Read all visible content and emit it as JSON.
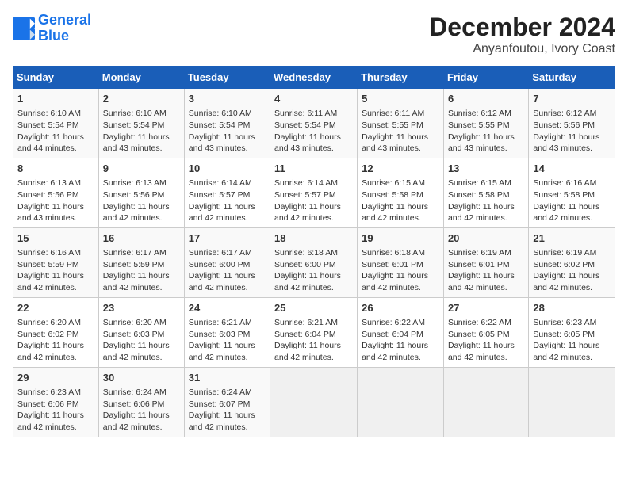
{
  "header": {
    "logo_line1": "General",
    "logo_line2": "Blue",
    "title": "December 2024",
    "subtitle": "Anyanfoutou, Ivory Coast"
  },
  "calendar": {
    "days_of_week": [
      "Sunday",
      "Monday",
      "Tuesday",
      "Wednesday",
      "Thursday",
      "Friday",
      "Saturday"
    ],
    "weeks": [
      [
        {
          "day": "1",
          "content": "Sunrise: 6:10 AM\nSunset: 5:54 PM\nDaylight: 11 hours\nand 44 minutes."
        },
        {
          "day": "2",
          "content": "Sunrise: 6:10 AM\nSunset: 5:54 PM\nDaylight: 11 hours\nand 43 minutes."
        },
        {
          "day": "3",
          "content": "Sunrise: 6:10 AM\nSunset: 5:54 PM\nDaylight: 11 hours\nand 43 minutes."
        },
        {
          "day": "4",
          "content": "Sunrise: 6:11 AM\nSunset: 5:54 PM\nDaylight: 11 hours\nand 43 minutes."
        },
        {
          "day": "5",
          "content": "Sunrise: 6:11 AM\nSunset: 5:55 PM\nDaylight: 11 hours\nand 43 minutes."
        },
        {
          "day": "6",
          "content": "Sunrise: 6:12 AM\nSunset: 5:55 PM\nDaylight: 11 hours\nand 43 minutes."
        },
        {
          "day": "7",
          "content": "Sunrise: 6:12 AM\nSunset: 5:56 PM\nDaylight: 11 hours\nand 43 minutes."
        }
      ],
      [
        {
          "day": "8",
          "content": "Sunrise: 6:13 AM\nSunset: 5:56 PM\nDaylight: 11 hours\nand 43 minutes."
        },
        {
          "day": "9",
          "content": "Sunrise: 6:13 AM\nSunset: 5:56 PM\nDaylight: 11 hours\nand 42 minutes."
        },
        {
          "day": "10",
          "content": "Sunrise: 6:14 AM\nSunset: 5:57 PM\nDaylight: 11 hours\nand 42 minutes."
        },
        {
          "day": "11",
          "content": "Sunrise: 6:14 AM\nSunset: 5:57 PM\nDaylight: 11 hours\nand 42 minutes."
        },
        {
          "day": "12",
          "content": "Sunrise: 6:15 AM\nSunset: 5:58 PM\nDaylight: 11 hours\nand 42 minutes."
        },
        {
          "day": "13",
          "content": "Sunrise: 6:15 AM\nSunset: 5:58 PM\nDaylight: 11 hours\nand 42 minutes."
        },
        {
          "day": "14",
          "content": "Sunrise: 6:16 AM\nSunset: 5:58 PM\nDaylight: 11 hours\nand 42 minutes."
        }
      ],
      [
        {
          "day": "15",
          "content": "Sunrise: 6:16 AM\nSunset: 5:59 PM\nDaylight: 11 hours\nand 42 minutes."
        },
        {
          "day": "16",
          "content": "Sunrise: 6:17 AM\nSunset: 5:59 PM\nDaylight: 11 hours\nand 42 minutes."
        },
        {
          "day": "17",
          "content": "Sunrise: 6:17 AM\nSunset: 6:00 PM\nDaylight: 11 hours\nand 42 minutes."
        },
        {
          "day": "18",
          "content": "Sunrise: 6:18 AM\nSunset: 6:00 PM\nDaylight: 11 hours\nand 42 minutes."
        },
        {
          "day": "19",
          "content": "Sunrise: 6:18 AM\nSunset: 6:01 PM\nDaylight: 11 hours\nand 42 minutes."
        },
        {
          "day": "20",
          "content": "Sunrise: 6:19 AM\nSunset: 6:01 PM\nDaylight: 11 hours\nand 42 minutes."
        },
        {
          "day": "21",
          "content": "Sunrise: 6:19 AM\nSunset: 6:02 PM\nDaylight: 11 hours\nand 42 minutes."
        }
      ],
      [
        {
          "day": "22",
          "content": "Sunrise: 6:20 AM\nSunset: 6:02 PM\nDaylight: 11 hours\nand 42 minutes."
        },
        {
          "day": "23",
          "content": "Sunrise: 6:20 AM\nSunset: 6:03 PM\nDaylight: 11 hours\nand 42 minutes."
        },
        {
          "day": "24",
          "content": "Sunrise: 6:21 AM\nSunset: 6:03 PM\nDaylight: 11 hours\nand 42 minutes."
        },
        {
          "day": "25",
          "content": "Sunrise: 6:21 AM\nSunset: 6:04 PM\nDaylight: 11 hours\nand 42 minutes."
        },
        {
          "day": "26",
          "content": "Sunrise: 6:22 AM\nSunset: 6:04 PM\nDaylight: 11 hours\nand 42 minutes."
        },
        {
          "day": "27",
          "content": "Sunrise: 6:22 AM\nSunset: 6:05 PM\nDaylight: 11 hours\nand 42 minutes."
        },
        {
          "day": "28",
          "content": "Sunrise: 6:23 AM\nSunset: 6:05 PM\nDaylight: 11 hours\nand 42 minutes."
        }
      ],
      [
        {
          "day": "29",
          "content": "Sunrise: 6:23 AM\nSunset: 6:06 PM\nDaylight: 11 hours\nand 42 minutes."
        },
        {
          "day": "30",
          "content": "Sunrise: 6:24 AM\nSunset: 6:06 PM\nDaylight: 11 hours\nand 42 minutes."
        },
        {
          "day": "31",
          "content": "Sunrise: 6:24 AM\nSunset: 6:07 PM\nDaylight: 11 hours\nand 42 minutes."
        },
        null,
        null,
        null,
        null
      ]
    ]
  }
}
